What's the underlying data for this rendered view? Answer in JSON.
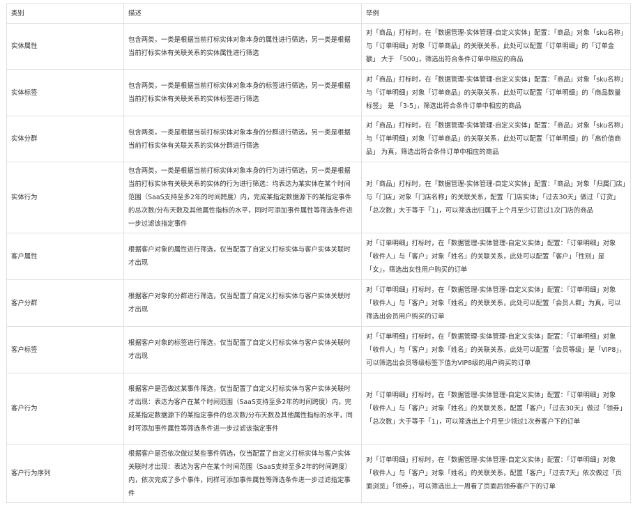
{
  "headers": [
    "类别",
    "描述",
    "举例"
  ],
  "rows": [
    {
      "category": "实体属性",
      "description": "包含两类，一类是根据当前打标实体对象本身的属性进行筛选，另一类是根据当前打标实体有关联关系的实体属性进行筛选",
      "example": "对「商品」打标时，在「数据管理-实体管理-自定义实体」配置：「商品」对象「sku名称」与「订单明细」对象「订单商品」的关联关系，此处可以配置「订单明细」的「订单金额」 大于 「500」，筛选出符合条件订单中相应的商品"
    },
    {
      "category": "实体标签",
      "description": "包含两类，一类是根据当前打标实体对象本身的标签进行筛选，另一类是根据当前打标实体有关联关系的实体标签进行筛选",
      "example": "对「商品」打标时，在「数据管理-实体管理-自定义实体」配置：「商品」对象「sku名称」与「订单明细」对象「订单商品」的关联关系，此处可以配置「订单明细」的「商品数量标签」 是 「3-5」，筛选出符合条件订单中相应的商品"
    },
    {
      "category": "实体分群",
      "description": "包含两类，一类是根据当前打标实体对象本身的分群进行筛选，另一类是根据当前打标实体有关联关系的实体分群进行筛选",
      "example": "对「商品」打标时，在「数据管理-实体管理-自定义实体」配置：「商品」对象「sku名称」与「订单明细」对象「订单商品」的关联关系，此处可以配置「订单明细」的「高价值商品」 为真，筛选出符合条件订单中相应的商品"
    },
    {
      "category": "实体行为",
      "description": "包含两类，一类是根据当前打标实体对象本身的行为进行筛选，另一类是根据当前打标实体有关联关系的实体的行为进行筛选：均表达为某实体在某个时间范围（SaaS支持至多2年的时间跨度）内，完成某指定数据源下的某指定事件的总次数/分布天数及其他属性指标的水平，同时可添加事件属性等筛选条件进一步过滤该指定事件",
      "example": "对「商品」打标时，在「数据管理-实体管理-自定义实体」配置：「商品」对象「归属门店」与「门店」对象「门店名称」的关联关系，配置「门店实体」「过去30天」做过「订货」「总次数」大于等于「1」，可以筛选出归属于上个月至少订货过1次门店的商品"
    },
    {
      "category": "客户属性",
      "description": "根据客户对象的属性进行筛选，仅当配置了自定义打标实体与客户实体关联时才出现",
      "example": "对「订单明细」打标时，在「数据管理-实体管理-自定义实体」配置：「订单明细」对象「收件人」与「客户」对象「姓名」的关联关系，此处可以配置「客户」「性别」是「女」，筛选出女性用户购买的订单"
    },
    {
      "category": "客户分群",
      "description": "根据客户对象的分群进行筛选，仅当配置了自定义打标实体与客户实体关联时才出现",
      "example": "对「订单明细」打标时，在「数据管理-实体管理-自定义实体」配置：「订单明细」对象「收件人」与「客户」对象「姓名」的关联关系，此处可以配置「会员人群」为真，可以筛选出会员用户购买的订单"
    },
    {
      "category": "客户标签",
      "description": "根据客户对象的标签进行筛选，仅当配置了自定义打标实体与客户实体关联时才出现",
      "example": "对「订单明细」打标时，在「数据管理-实体管理-自定义实体」配置：「订单明细」对象「收件人」与「客户」对象「姓名」的关联关系，此处可以配置「会员等级」是「VIP8」，可以筛选出会员等级标签下值为VIP8级的用户购买的订单"
    },
    {
      "category": "客户行为",
      "description": "根据客户是否做过某事件筛选，仅当配置了自定义打标实体与客户实体关联时才出现：表达为客户在某个时间范围（SaaS支持至多2年的时间跨度）内，完成某指定数据源下的某指定事件的总次数/分布天数及其他属性指标的水平，同时可添加事件属性等筛选条件进一步过滤该指定事件",
      "example": "对「订单明细」打标时，在「数据管理-实体管理-自定义实体」配置：「订单明细」对象「收件人」与「客户」对象「姓名」的关联关系，配置「客户」「过去30天」做过「领券」「总次数」大于等于「1」，可以筛选出上个月至少领过1次券客户下的订单"
    },
    {
      "category": "客户行为序列",
      "description": "根据客户是否依次做过某些事件筛选，仅当配置了自定义打标实体与客户实体关联时才出现：表达为客户在某个时间范围（SaaS支持至多2年的时间跨度）内，依次完成了多个事件，同样可添加事件属性等筛选条件进一步过滤指定事件",
      "example": "对「订单明细」打标时，在「数据管理-实体管理-自定义实体」配置：「订单明细」对象「收件人」与「客户」对象「姓名」的关联关系，配置「客户」「过去7天」依次做过「页面浏览」「领券」，可以筛选出上一周看了页面后领券客户下的订单"
    }
  ]
}
